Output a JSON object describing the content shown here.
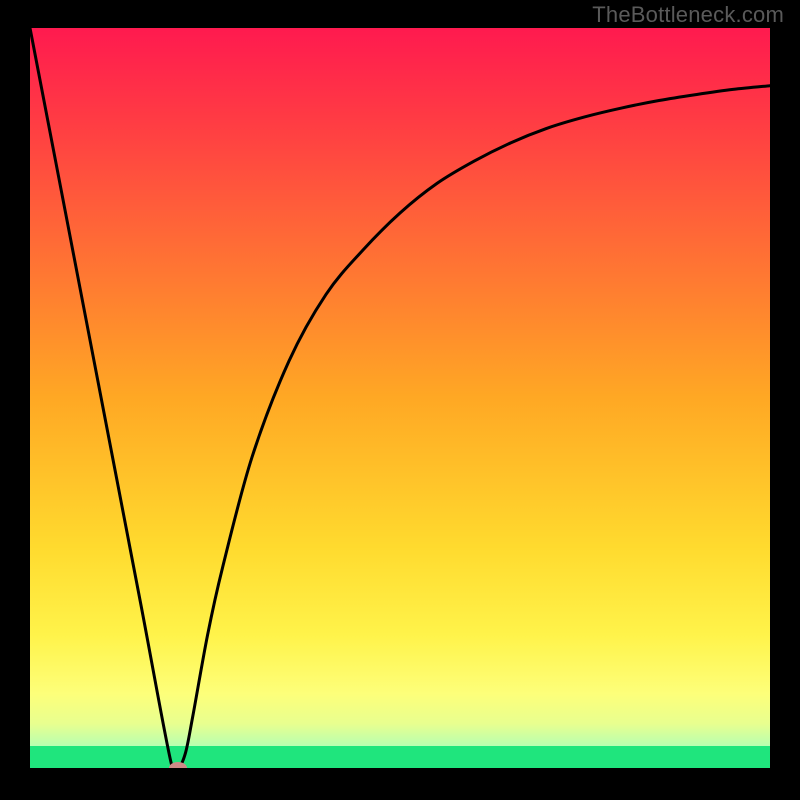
{
  "watermark": "TheBottleneck.com",
  "chart_data": {
    "type": "line",
    "title": "",
    "xlabel": "",
    "ylabel": "",
    "xlim": [
      0,
      100
    ],
    "ylim": [
      0,
      100
    ],
    "series": [
      {
        "name": "bottleneck-curve",
        "x": [
          0,
          5,
          10,
          15,
          19,
          20,
          21,
          22,
          24,
          26,
          30,
          35,
          40,
          45,
          50,
          55,
          60,
          65,
          70,
          75,
          80,
          85,
          90,
          95,
          100
        ],
        "y": [
          100,
          74,
          48,
          22,
          1,
          0,
          2,
          7,
          18,
          27,
          42,
          55,
          64,
          70,
          75,
          79,
          82,
          84.5,
          86.5,
          88,
          89.2,
          90.2,
          91,
          91.7,
          92.2
        ]
      }
    ],
    "marker": {
      "x": 20,
      "y": 0,
      "color": "#cf8b88"
    },
    "gradient_stops": [
      {
        "offset": 0,
        "color": "#ff1a4f"
      },
      {
        "offset": 12,
        "color": "#ff3a44"
      },
      {
        "offset": 30,
        "color": "#ff6e35"
      },
      {
        "offset": 50,
        "color": "#ffa824"
      },
      {
        "offset": 70,
        "color": "#ffda2e"
      },
      {
        "offset": 82,
        "color": "#fff34a"
      },
      {
        "offset": 90,
        "color": "#fdff7a"
      },
      {
        "offset": 94,
        "color": "#e8ff8f"
      },
      {
        "offset": 97,
        "color": "#b8ffb0"
      },
      {
        "offset": 100,
        "color": "#22e07a"
      }
    ],
    "green_band": {
      "from_pct": 97.0,
      "to_pct": 100,
      "color": "#1fe57d"
    }
  }
}
